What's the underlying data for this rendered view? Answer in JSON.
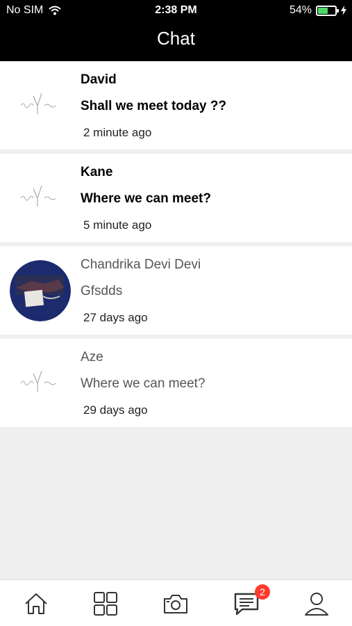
{
  "status_bar": {
    "carrier": "No SIM",
    "time": "2:38 PM",
    "battery_pct": "54%",
    "battery_level": 0.54
  },
  "header": {
    "title": "Chat"
  },
  "chats": [
    {
      "name": "David",
      "message": "Shall we meet today ??",
      "time_ago": "2 minute ago",
      "avatar": "logo-placeholder",
      "unread": true
    },
    {
      "name": "Kane",
      "message": "Where we can meet?",
      "time_ago": "5 minute ago",
      "avatar": "logo-placeholder",
      "unread": true
    },
    {
      "name": "Chandrika Devi Devi",
      "message": "Gfsdds",
      "time_ago": "27 days ago",
      "avatar": "photo",
      "unread": false
    },
    {
      "name": "Aze",
      "message": "Where we can meet?",
      "time_ago": "29 days ago",
      "avatar": "logo-placeholder",
      "unread": false
    }
  ],
  "tab_bar": {
    "items": [
      {
        "icon": "home-icon"
      },
      {
        "icon": "grid-icon"
      },
      {
        "icon": "camera-icon"
      },
      {
        "icon": "chat-icon",
        "badge": "2",
        "active": true
      },
      {
        "icon": "profile-icon"
      }
    ]
  },
  "colors": {
    "header_bg": "#000000",
    "badge": "#ff3b30",
    "battery": "#4cd964"
  }
}
